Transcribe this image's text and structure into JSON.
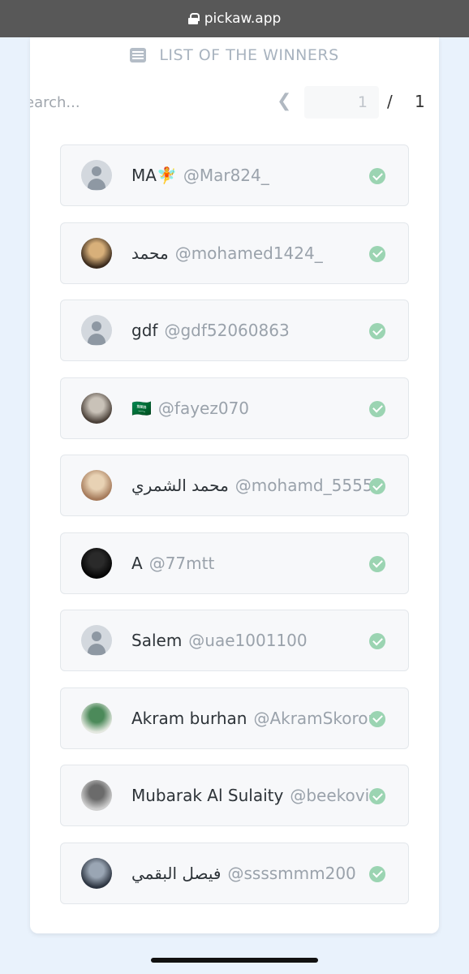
{
  "browser": {
    "url": "pickaw.app"
  },
  "heading": {
    "title": "LIST OF THE WINNERS"
  },
  "search": {
    "placeholder": "Search...",
    "visible_text": "earch..."
  },
  "pagination": {
    "current": "1",
    "separator": "/",
    "total": "1"
  },
  "colors": {
    "check": "#9bd4b2",
    "row_bg": "#f7f8fa",
    "handle": "#9aa2ab"
  },
  "winners": [
    {
      "name": "MA🧚",
      "handle": "@Mar824_",
      "avatar": "default"
    },
    {
      "name": "محمد",
      "handle": "@mohamed1424_",
      "avatar": "photo"
    },
    {
      "name": "gdf",
      "handle": "@gdf52060863",
      "avatar": "default"
    },
    {
      "name": "🇸🇦",
      "handle": "@fayez070",
      "avatar": "photo"
    },
    {
      "name": "محمد الشمري",
      "handle": "@mohamd_5555",
      "avatar": "photo"
    },
    {
      "name": "A",
      "handle": "@77mtt",
      "avatar": "photo"
    },
    {
      "name": "Salem",
      "handle": "@uae1001100",
      "avatar": "default"
    },
    {
      "name": "Akram burhan",
      "handle": "@AkramSkorou",
      "avatar": "photo"
    },
    {
      "name": "Mubarak Al Sulaity",
      "handle": "@beekovic",
      "avatar": "photo"
    },
    {
      "name": "فيصل البقمي",
      "handle": "@ssssmmm200",
      "avatar": "photo"
    }
  ]
}
